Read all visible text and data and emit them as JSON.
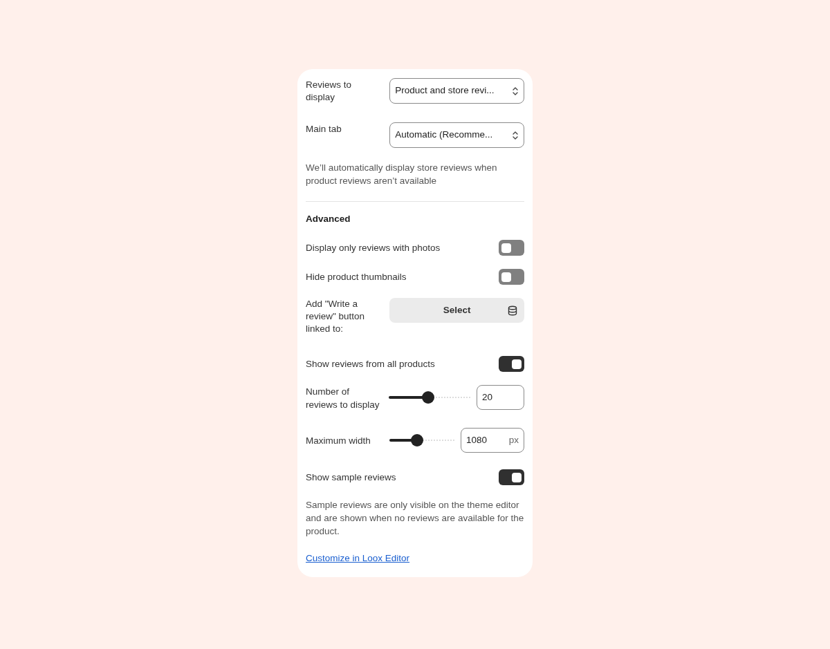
{
  "top": [
    {
      "kind": "select",
      "label": "Reviews to display",
      "value": "Product and store revi..."
    },
    {
      "kind": "select",
      "label": "Main tab",
      "value": "Automatic (Recomme..."
    },
    {
      "kind": "note",
      "text": "We’ll automatically display store reviews when product reviews aren’t available"
    }
  ],
  "advanced": {
    "heading": "Advanced",
    "items": [
      {
        "kind": "toggle",
        "label": "Display only reviews with photos",
        "on": false
      },
      {
        "kind": "toggle",
        "label": "Hide product thumbnails",
        "on": false
      },
      {
        "kind": "button",
        "label": "Add \"Write a review\" button linked to:",
        "button": "Select"
      },
      {
        "kind": "toggle",
        "label": "Show reviews from all products",
        "on": true
      },
      {
        "kind": "slider",
        "label": "Number of reviews to display",
        "level": 0.48,
        "value": "20"
      },
      {
        "kind": "slider",
        "label": "Maximum width",
        "level": 0.43,
        "value": "1080",
        "unit": "px"
      },
      {
        "kind": "toggle",
        "label": "Show sample reviews",
        "on": true
      },
      {
        "kind": "note",
        "text": "Sample reviews are only visible on the theme editor and are shown when no reviews are available for the product."
      },
      {
        "kind": "link",
        "text": "Customize in Loox Editor"
      }
    ]
  }
}
